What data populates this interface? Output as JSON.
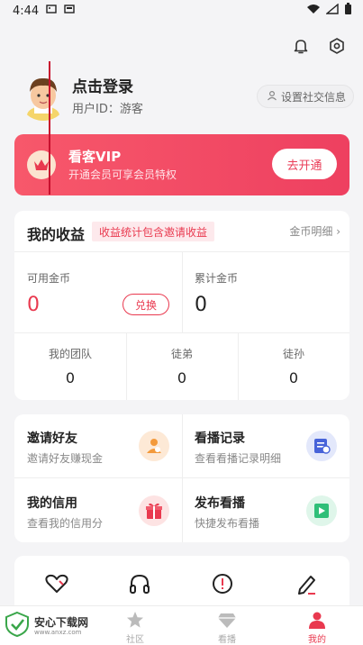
{
  "status_bar": {
    "time": "4:44"
  },
  "profile": {
    "login_label": "点击登录",
    "user_id_label": "用户ID：游客",
    "social_label": "设置社交信息"
  },
  "vip": {
    "title": "看客VIP",
    "subtitle": "开通会员可享会员特权",
    "button": "去开通"
  },
  "earnings": {
    "title": "我的收益",
    "tag": "收益统计包含邀请收益",
    "detail_link": "金币明细",
    "available_label": "可用金币",
    "available_value": "0",
    "exchange_button": "兑换",
    "total_label": "累计金币",
    "total_value": "0",
    "team": [
      {
        "label": "我的团队",
        "value": "0"
      },
      {
        "label": "徒弟",
        "value": "0"
      },
      {
        "label": "徒孙",
        "value": "0"
      }
    ]
  },
  "functions": [
    {
      "title": "邀请好友",
      "subtitle": "邀请好友赚现金",
      "icon": "invite-icon"
    },
    {
      "title": "看播记录",
      "subtitle": "查看看播记录明细",
      "icon": "record-icon"
    },
    {
      "title": "我的信用",
      "subtitle": "查看我的信用分",
      "icon": "gift-icon"
    },
    {
      "title": "发布看播",
      "subtitle": "快捷发布看播",
      "icon": "publish-icon"
    }
  ],
  "more_icons": [
    "heart-icon",
    "headphones-icon",
    "alert-icon",
    "edit-icon"
  ],
  "tabs": [
    {
      "label": "社区",
      "icon": "star-icon"
    },
    {
      "label": "看播",
      "icon": "diamond-icon"
    },
    {
      "label": "我的",
      "icon": "person-icon"
    }
  ],
  "watermark": {
    "title": "安心下载网",
    "url": "www.anxz.com"
  },
  "colors": {
    "accent": "#e9394f",
    "vip_gradient_start": "#f7586b",
    "vip_gradient_end": "#ee4060"
  }
}
